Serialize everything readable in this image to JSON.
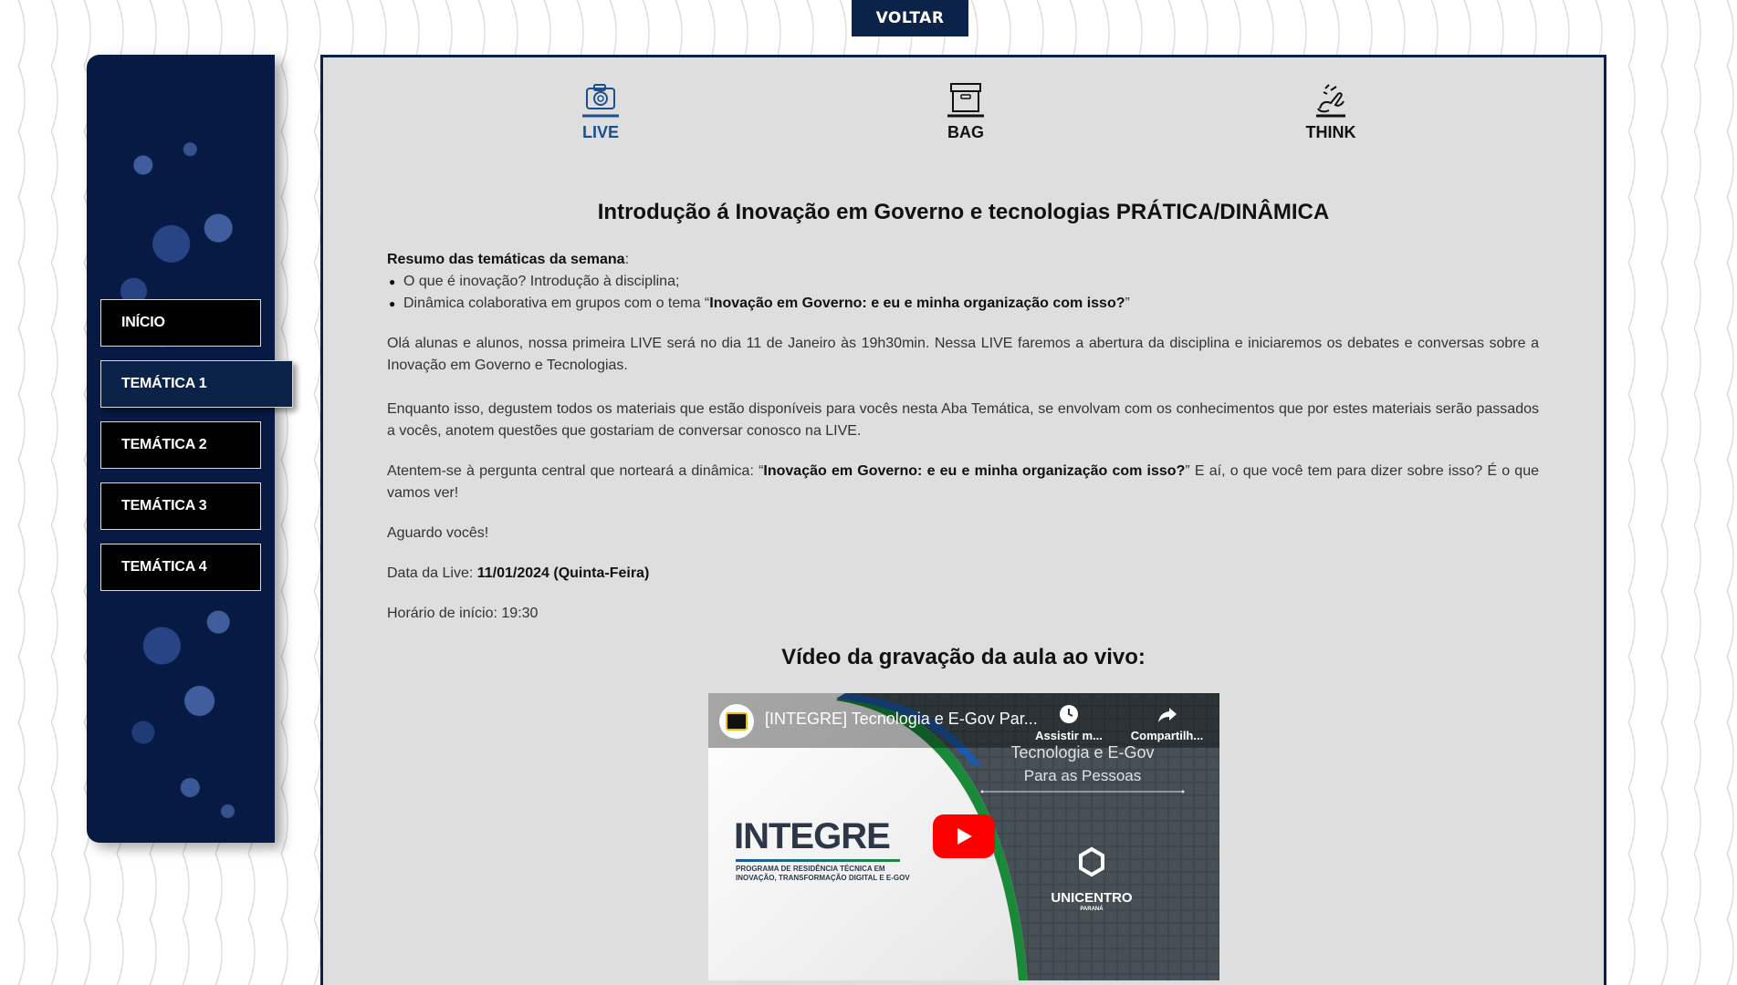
{
  "header": {
    "back_label": "VOLTAR"
  },
  "sidebar": {
    "items": [
      {
        "label": "INÍCIO"
      },
      {
        "label": "TEMÁTICA 1"
      },
      {
        "label": "TEMÁTICA 2"
      },
      {
        "label": "TEMÁTICA 3"
      },
      {
        "label": "TEMÁTICA 4"
      }
    ],
    "active_index": 1
  },
  "tabs": [
    {
      "label": "LIVE",
      "icon": "camera-icon",
      "active": true
    },
    {
      "label": "BAG",
      "icon": "archive-box-icon",
      "active": false
    },
    {
      "label": "THINK",
      "icon": "hand-idea-icon",
      "active": false
    }
  ],
  "main": {
    "title": "Introdução á Inovação em Governo e tecnologias PRÁTICA/DINÂMICA",
    "summary_label": "Resumo das temáticas da semana",
    "summary_colon": ":",
    "bullet_1": "O que é inovação? Introdução à disciplina;",
    "bullet_2_prefix": "Dinâmica colaborativa em grupos com o tema “",
    "bullet_2_bold": "Inovação em Governo: e eu e minha organização com isso?",
    "bullet_2_suffix": "”",
    "para_1": "Olá alunas e alunos, nossa primeira LIVE será no dia 11 de Janeiro às 19h30min. Nessa LIVE faremos a abertura da disciplina e iniciaremos os debates e conversas sobre a Inovação em Governo e Tecnologias.",
    "para_2": "Enquanto isso, degustem todos os materiais que estão disponíveis para vocês nesta Aba Temática, se envolvam com os conhecimentos que por estes materiais serão passados a vocês, anotem questões que gostariam de conversar conosco na LIVE.",
    "para_3_prefix": "Atentem-se à pergunta central que norteará a dinâmica: “",
    "para_3_bold": "Inovação em Governo: e eu e minha organização com isso?",
    "para_3_suffix": "” E aí, o que você tem para dizer sobre isso? É o que vamos ver!",
    "para_4": "Aguardo vocês!",
    "date_label": "Data da Live: ",
    "date_value": "11/01/2024 (Quinta-Feira)",
    "time_label": "Horário de início: 19:30",
    "video_heading": "Vídeo da gravação da aula ao vivo:"
  },
  "video": {
    "title": "[INTEGRE] Tecnologia e E-Gov Par...",
    "watch_later": "Assistir m...",
    "share": "Compartilh...",
    "thumb_line_1": "Tecnologia e E-Gov",
    "thumb_line_2": "Para as Pessoas",
    "brand": "INTEGRE",
    "brand_sub_1": "PROGRAMA DE RESIDÊNCIA TÉCNICA EM",
    "brand_sub_2": "INOVAÇÃO, TRANSFORMAÇÃO DIGITAL E E-GOV",
    "university": "UNICENTRO",
    "university_sub": "PARANÁ"
  },
  "colors": {
    "navy": "#0b2249",
    "active_tab": "#1a4f8f",
    "youtube_red": "#ff0000"
  }
}
